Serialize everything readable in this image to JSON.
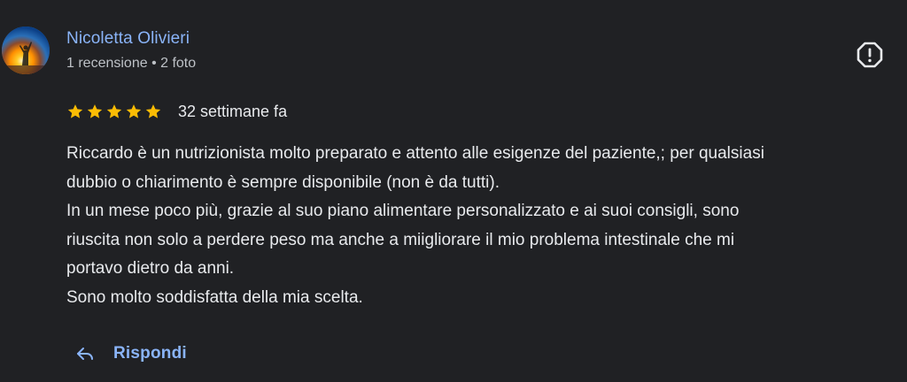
{
  "review": {
    "author": {
      "name": "Nicoletta Olivieri",
      "meta": "1 recensione • 2 foto",
      "avatar_icon": "person-sunset-photo"
    },
    "report_icon": "report-flag-icon",
    "rating": {
      "stars": 5,
      "max": 5,
      "star_color": "#fbbc04"
    },
    "time_ago": "32 settimane fa",
    "text_lines": [
      "Riccardo è un nutrizionista molto preparato e attento alle esigenze del paziente,; per qualsiasi",
      "dubbio o chiarimento è sempre disponibile (non è da tutti).",
      "In un mese poco più, grazie al suo piano alimentare personalizzato e ai suoi consigli, sono",
      "riuscita non solo a perdere peso ma anche a miigliorare il mio problema intestinale che mi",
      "portavo dietro da anni.",
      "Sono molto soddisfatta della mia scelta."
    ],
    "reply": {
      "label": "Rispondi",
      "icon": "reply-arrow-icon"
    }
  },
  "colors": {
    "background": "#202124",
    "link": "#8ab4f8",
    "text": "#e8eaed",
    "secondary_text": "#bdc1c6"
  }
}
